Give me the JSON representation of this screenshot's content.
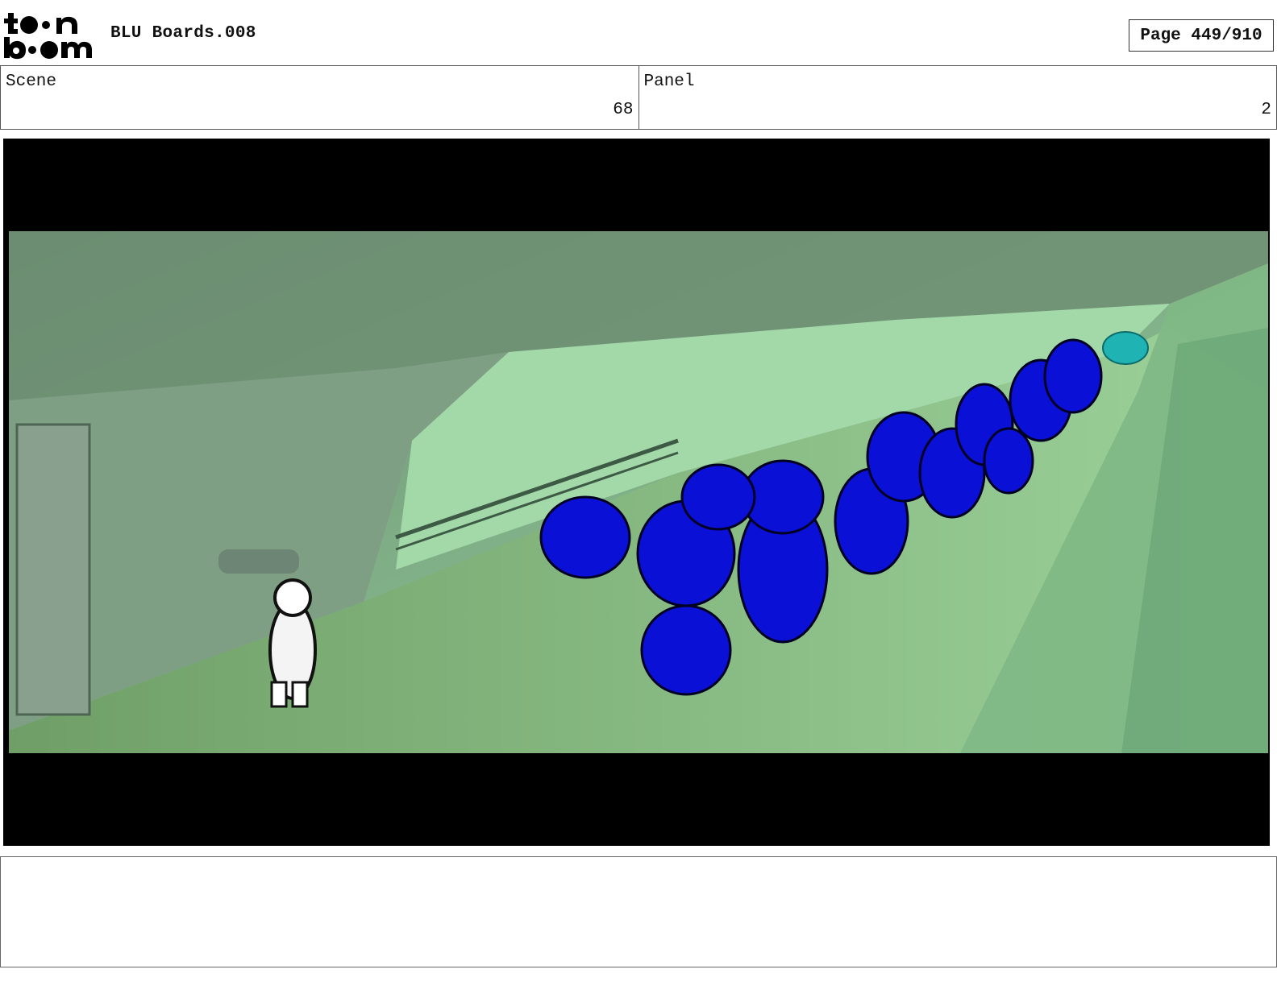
{
  "header": {
    "logo_text_top": "toon",
    "logo_text_bottom": "boom",
    "title": "BLU Boards.008",
    "page_label": "Page 449/910"
  },
  "info": {
    "scene_label": "Scene",
    "scene_value": "68",
    "panel_label": "Panel",
    "panel_value": "2"
  },
  "notes": {
    "text": ""
  }
}
